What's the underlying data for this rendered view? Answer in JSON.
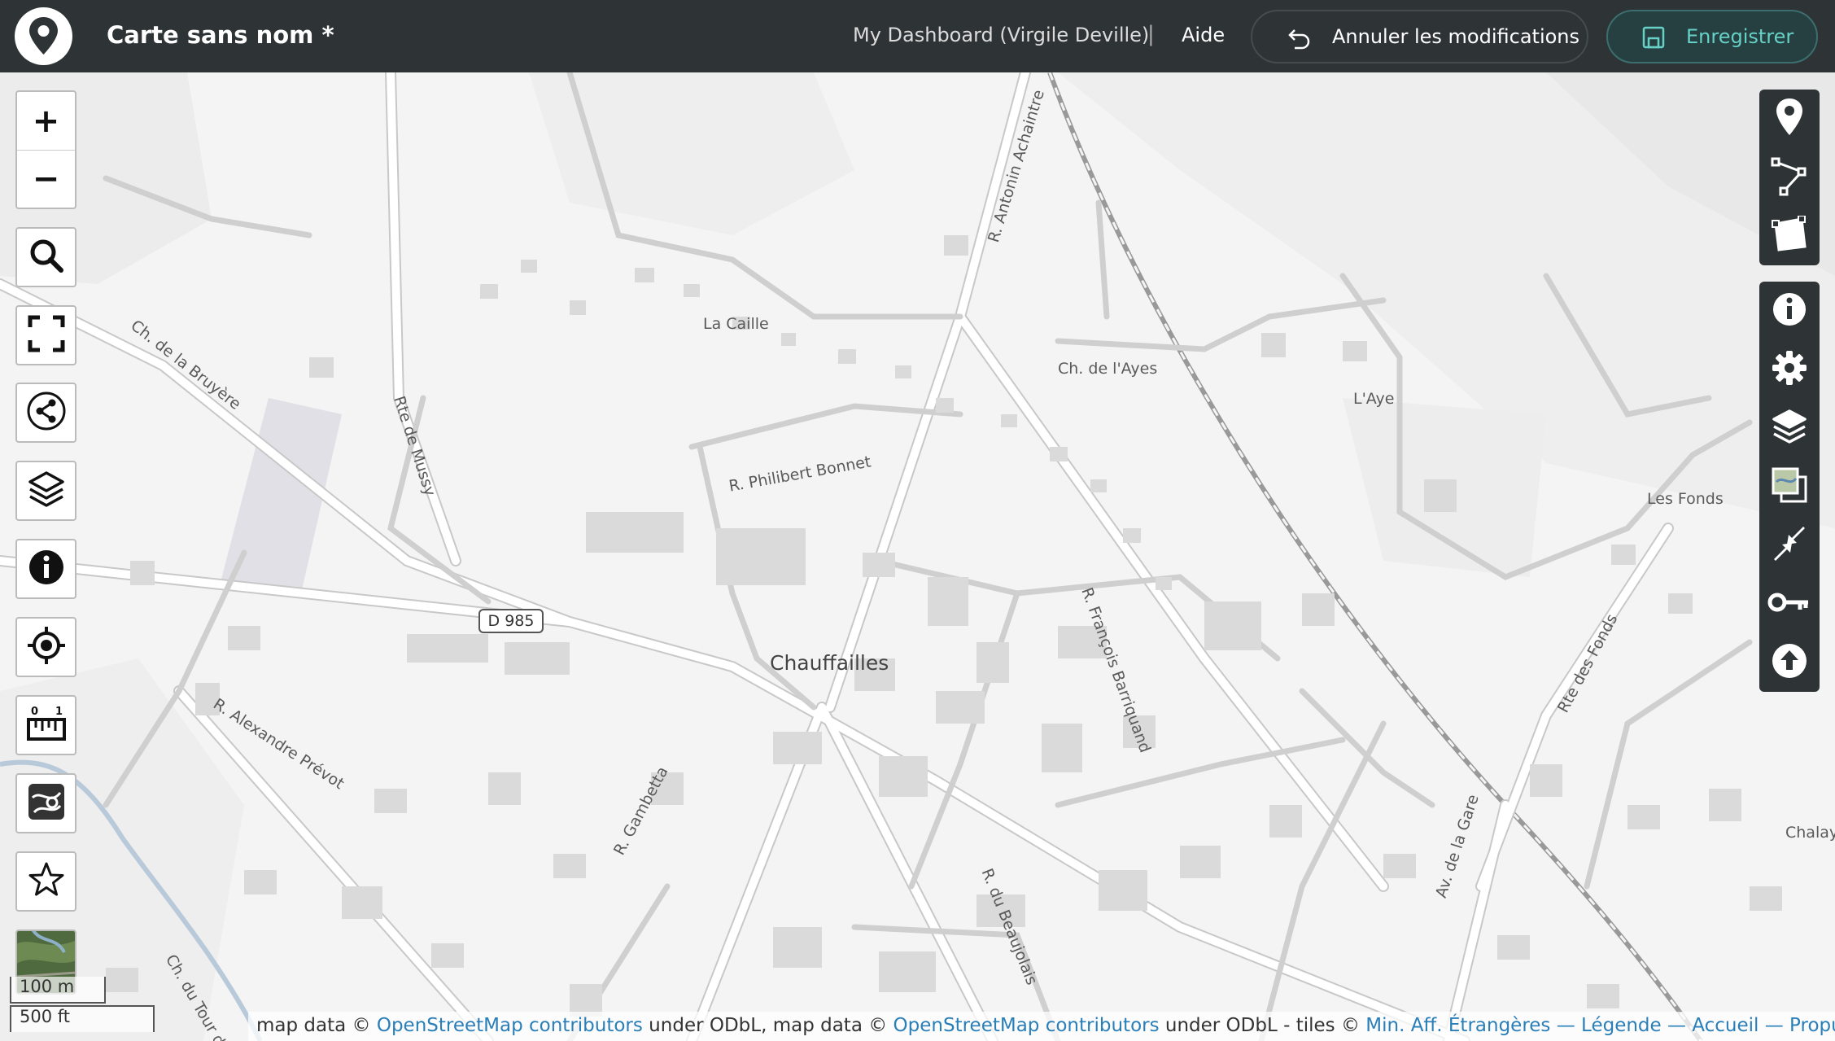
{
  "header": {
    "title": "Carte sans nom *",
    "dashboard_link": "My Dashboard (Virgile Deville)",
    "separator": "|",
    "help_link": "Aide",
    "cancel_label": "Annuler les modifications",
    "save_label": "Enregistrer",
    "colors": {
      "bar": "#2e3436",
      "save_accent": "#66d1c6"
    }
  },
  "map": {
    "labels": {
      "town": "Chauffailles",
      "la_caille": "La Caille",
      "laye": "L'Aye",
      "les_fonds": "Les Fonds",
      "chalay": "Chalay",
      "ch_bruyere": "Ch. de la Bruyère",
      "rte_mussy": "Rte de Mussy",
      "r_achaintre": "R. Antonin Achaintre",
      "ch_ayes": "Ch. de l'Ayes",
      "r_bonnet": "R. Philibert Bonnet",
      "r_barriquand": "R. François Barriquand",
      "r_prevot": "R. Alexandre Prévot",
      "r_gambetta": "R. Gambetta",
      "r_beaujolais": "R. du Beaujolais",
      "av_gare": "Av. de la Gare",
      "rte_fonds": "Rte des Fonds",
      "ch_tour": "Ch. du Tour d",
      "road_ref": "D 985"
    }
  },
  "left_controls": {
    "zoom_in": "+",
    "zoom_out": "−",
    "icons": [
      "search-icon",
      "fullscreen-icon",
      "share-icon",
      "layers-icon",
      "info-icon",
      "locate-icon",
      "measure-icon",
      "map-style-icon",
      "star-icon",
      "minimap-thumbnail"
    ]
  },
  "right_toolbar": {
    "draw_icons": [
      "marker-icon",
      "polyline-icon",
      "polygon-icon"
    ],
    "settings_icons": [
      "info-icon",
      "gear-icon",
      "layers-icon",
      "tilelayer-icon",
      "center-icon",
      "key-icon",
      "upload-icon"
    ]
  },
  "scale": {
    "metric": "100 m",
    "imperial": "500 ft"
  },
  "attribution": {
    "part1": "map data © ",
    "link1": "OpenStreetMap contributors",
    "part2": " under ODbL, map data © ",
    "link2": "OpenStreetMap contributors",
    "part3": " under ODbL - tiles © ",
    "link3": "Min. Aff. Étrangères — Légende — Accueil — Propulsé par uMap"
  }
}
